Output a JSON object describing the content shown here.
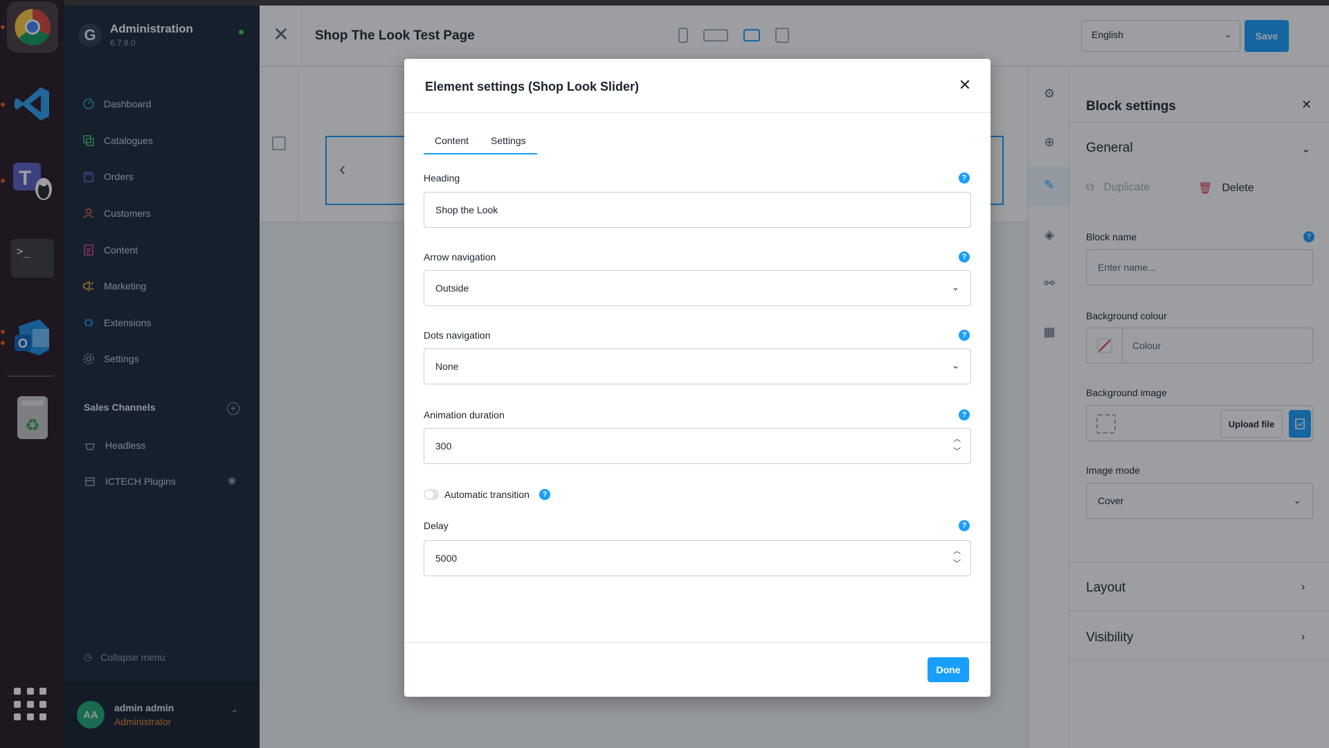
{
  "dock": {
    "apps": [
      {
        "name": "chrome-icon"
      },
      {
        "name": "vscode-icon"
      },
      {
        "name": "teams-icon"
      },
      {
        "name": "terminal-icon"
      },
      {
        "name": "outlook-icon"
      },
      {
        "name": "trash-icon"
      }
    ]
  },
  "admin": {
    "title": "Administration",
    "version": "6.7.8.0",
    "nav": [
      {
        "label": "Dashboard",
        "icon": "dashboard-icon"
      },
      {
        "label": "Catalogues",
        "icon": "catalogue-icon"
      },
      {
        "label": "Orders",
        "icon": "orders-icon"
      },
      {
        "label": "Customers",
        "icon": "customers-icon"
      },
      {
        "label": "Content",
        "icon": "content-icon"
      },
      {
        "label": "Marketing",
        "icon": "marketing-icon"
      },
      {
        "label": "Extensions",
        "icon": "extensions-icon"
      },
      {
        "label": "Settings",
        "icon": "settings-icon"
      }
    ],
    "sales_channels_title": "Sales Channels",
    "sales_channels": [
      {
        "label": "Headless"
      },
      {
        "label": "ICTECH Plugins"
      }
    ],
    "collapse_label": "Collapse menu",
    "user": {
      "initials": "AA",
      "name": "admin admin",
      "role": "Administrator"
    }
  },
  "editor": {
    "page_title": "Shop The Look Test Page",
    "language": "English",
    "save_label": "Save",
    "active_device": "desktop"
  },
  "block_panel": {
    "title": "Block settings",
    "general_label": "General",
    "duplicate_label": "Duplicate",
    "delete_label": "Delete",
    "block_name_label": "Block name",
    "block_name_placeholder": "Enter name...",
    "bg_colour_label": "Background colour",
    "bg_colour_placeholder": "Colour",
    "bg_image_label": "Background image",
    "upload_label": "Upload file",
    "image_mode_label": "Image mode",
    "image_mode_value": "Cover",
    "layout_label": "Layout",
    "visibility_label": "Visibility"
  },
  "modal": {
    "title": "Element settings (Shop Look Slider)",
    "tabs": [
      {
        "label": "Content"
      },
      {
        "label": "Settings"
      }
    ],
    "heading_label": "Heading",
    "heading_value": "Shop the Look",
    "arrow_label": "Arrow navigation",
    "arrow_value": "Outside",
    "dots_label": "Dots navigation",
    "dots_value": "None",
    "duration_label": "Animation duration",
    "duration_value": "300",
    "auto_label": "Automatic transition",
    "auto_on": false,
    "delay_label": "Delay",
    "delay_value": "5000",
    "done_label": "Done"
  },
  "colors": {
    "accent": "#189eff",
    "sidebar_bg": "#192536",
    "dock_bg": "#27181f"
  }
}
